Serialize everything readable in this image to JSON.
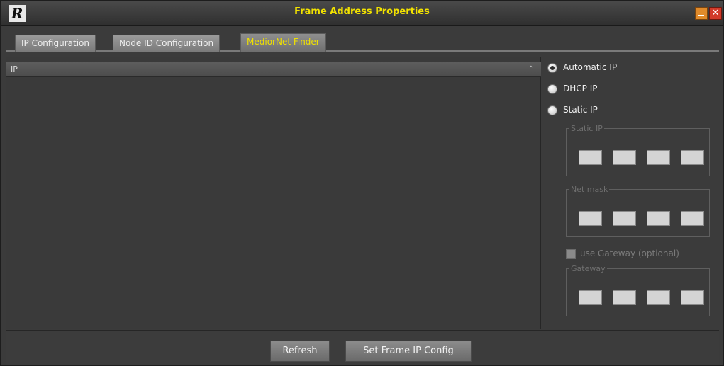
{
  "window": {
    "title": "Frame Address Properties",
    "logo": "R"
  },
  "tabs": [
    {
      "label": "IP Configuration"
    },
    {
      "label": "Node ID Configuration"
    },
    {
      "label": "MediorNet Finder"
    }
  ],
  "table": {
    "column_header": "IP",
    "sort_indicator": "⌃"
  },
  "options": {
    "automatic_ip": "Automatic IP",
    "dhcp_ip": "DHCP IP",
    "static_ip": "Static IP",
    "selected": "automatic_ip"
  },
  "groups": {
    "static_ip_label": "Static IP",
    "net_mask_label": "Net mask",
    "gateway_label": "Gateway"
  },
  "use_gateway_label": "use Gateway (optional)",
  "buttons": {
    "refresh": "Refresh",
    "set_frame": "Set Frame IP Config"
  },
  "colors": {
    "title": "#f2e200",
    "active_tab_text": "#efe000",
    "background": "#3a3a3a"
  },
  "icons": {
    "logo": "app-logo-icon",
    "minimize": "minimize-icon",
    "close": "close-icon"
  }
}
